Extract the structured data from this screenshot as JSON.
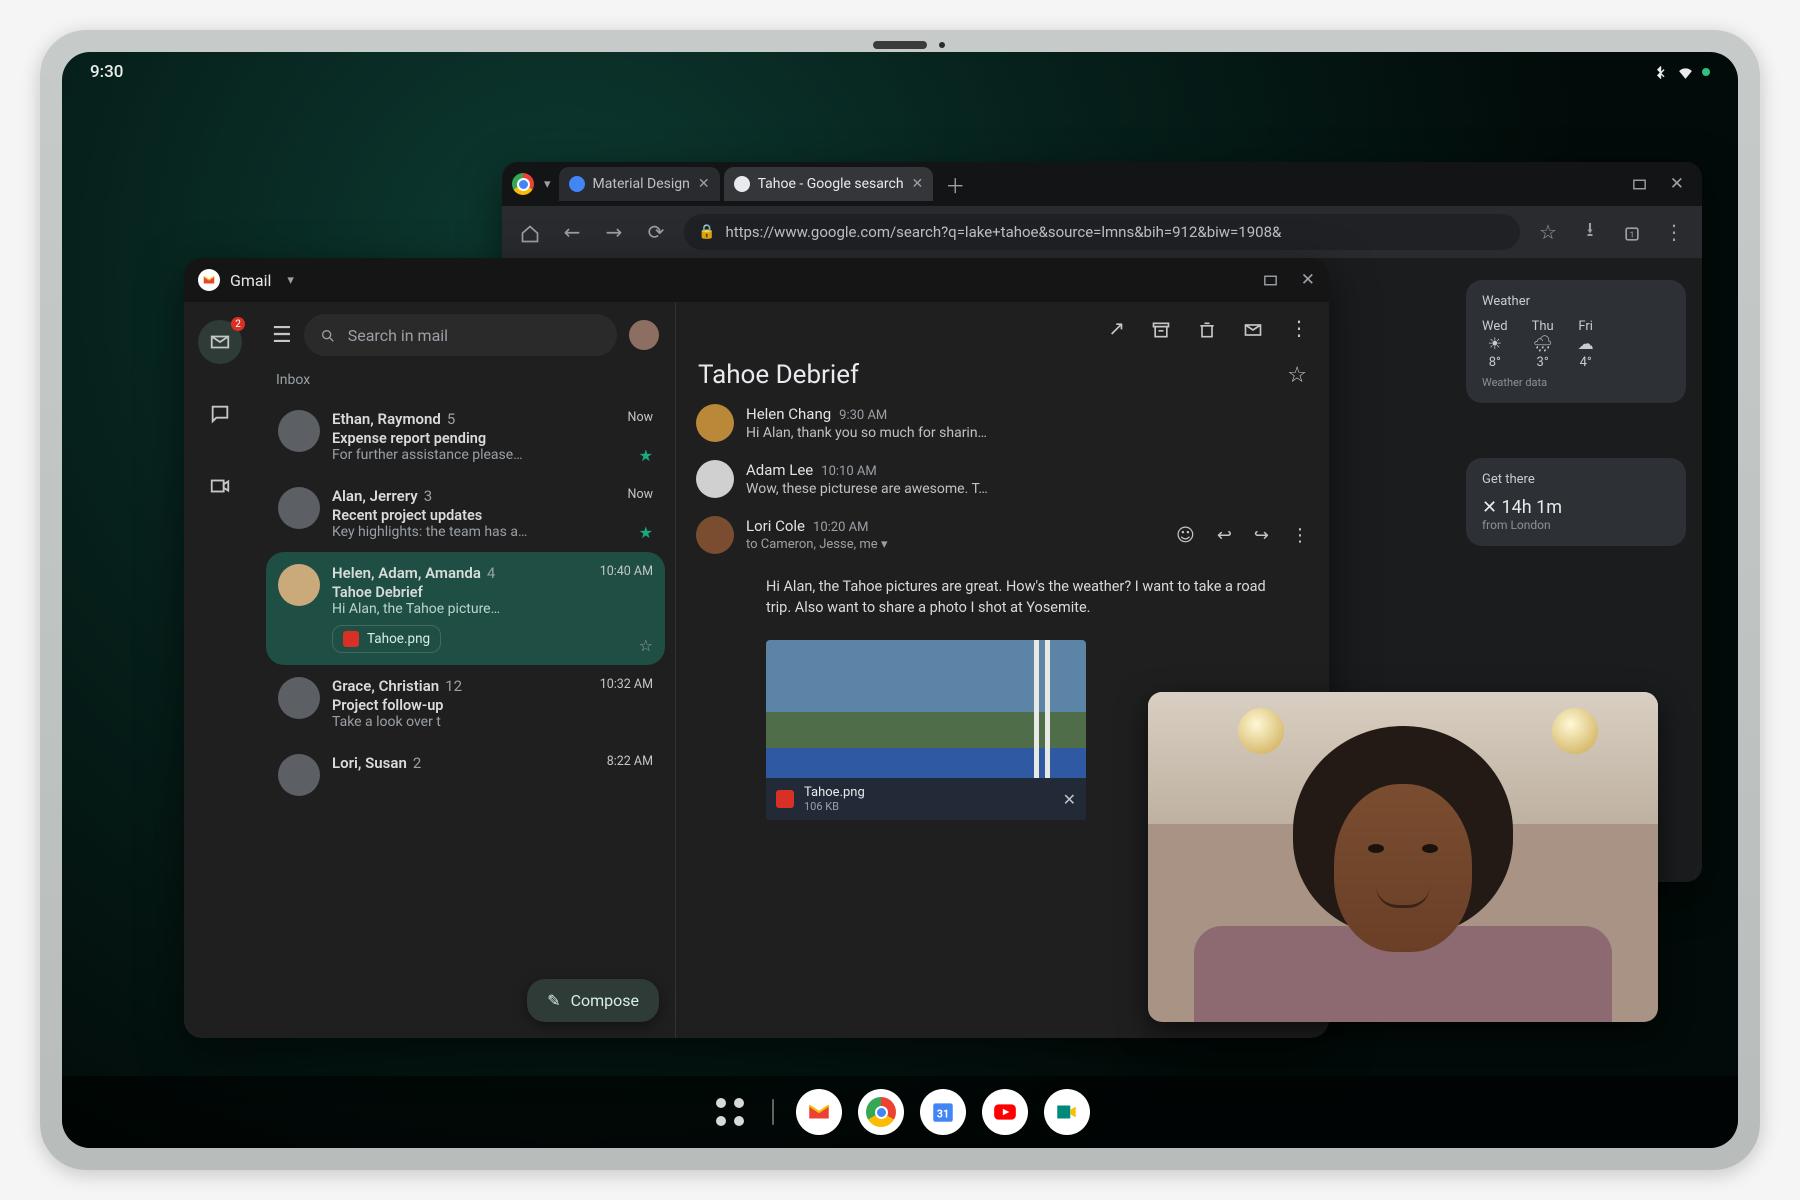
{
  "status": {
    "time": "9:30"
  },
  "chrome": {
    "tabs": [
      {
        "label": "Material Design"
      },
      {
        "label": "Tahoe - Google sesarch"
      }
    ],
    "url": "https://www.google.com/search?q=lake+tahoe&source=lmns&bih=912&biw=1908&",
    "cards": {
      "weather": {
        "title": "Weather",
        "days": [
          {
            "label": "Wed",
            "temp": "8°",
            "ico": "☀"
          },
          {
            "label": "Thu",
            "temp": "3°",
            "ico": "🌧"
          },
          {
            "label": "Fri",
            "temp": "4°",
            "ico": "☁"
          }
        ],
        "footer": "Weather data"
      },
      "route": {
        "title": "Get there",
        "line1": "✕ 14h 1m",
        "line2": "from London"
      }
    }
  },
  "gmail": {
    "app_title": "Gmail",
    "search_placeholder": "Search in mail",
    "section": "Inbox",
    "compose": "Compose",
    "threads": [
      {
        "senders": "Ethan, Raymond",
        "count": "5",
        "subject": "Expense report pending",
        "preview": "For further assistance please…",
        "time": "Now",
        "starred": true
      },
      {
        "senders": "Alan, Jerrery",
        "count": "3",
        "subject": "Recent project updates",
        "preview": "Key highlights: the team has a…",
        "time": "Now",
        "starred": true
      },
      {
        "senders": "Helen, Adam, Amanda",
        "count": "4",
        "subject": "Tahoe Debrief",
        "preview": "Hi Alan, the Tahoe picture…",
        "time": "10:40 AM",
        "selected": true,
        "attachment": "Tahoe.png"
      },
      {
        "senders": "Grace, Christian",
        "count": "12",
        "subject": "Project follow-up",
        "preview": "Take a look over t",
        "time": "10:32 AM"
      },
      {
        "senders": "Lori, Susan",
        "count": "2",
        "subject": "",
        "preview": "",
        "time": "8:22 AM"
      }
    ],
    "reader": {
      "title": "Tahoe Debrief",
      "messages": [
        {
          "from": "Helen Chang",
          "ts": "9:30 AM",
          "snippet": "Hi Alan, thank you so much for sharin…"
        },
        {
          "from": "Adam Lee",
          "ts": "10:10 AM",
          "snippet": "Wow, these picturese are awesome. T…"
        }
      ],
      "expanded": {
        "from": "Lori Cole",
        "ts": "10:20 AM",
        "to": "to Cameron, Jesse, me",
        "body": "Hi Alan, the Tahoe pictures are great. How's the weather? I want to take a road trip. Also want to share a photo I shot at Yosemite.",
        "attachment": {
          "name": "Tahoe.png",
          "size": "106 KB"
        }
      }
    }
  }
}
